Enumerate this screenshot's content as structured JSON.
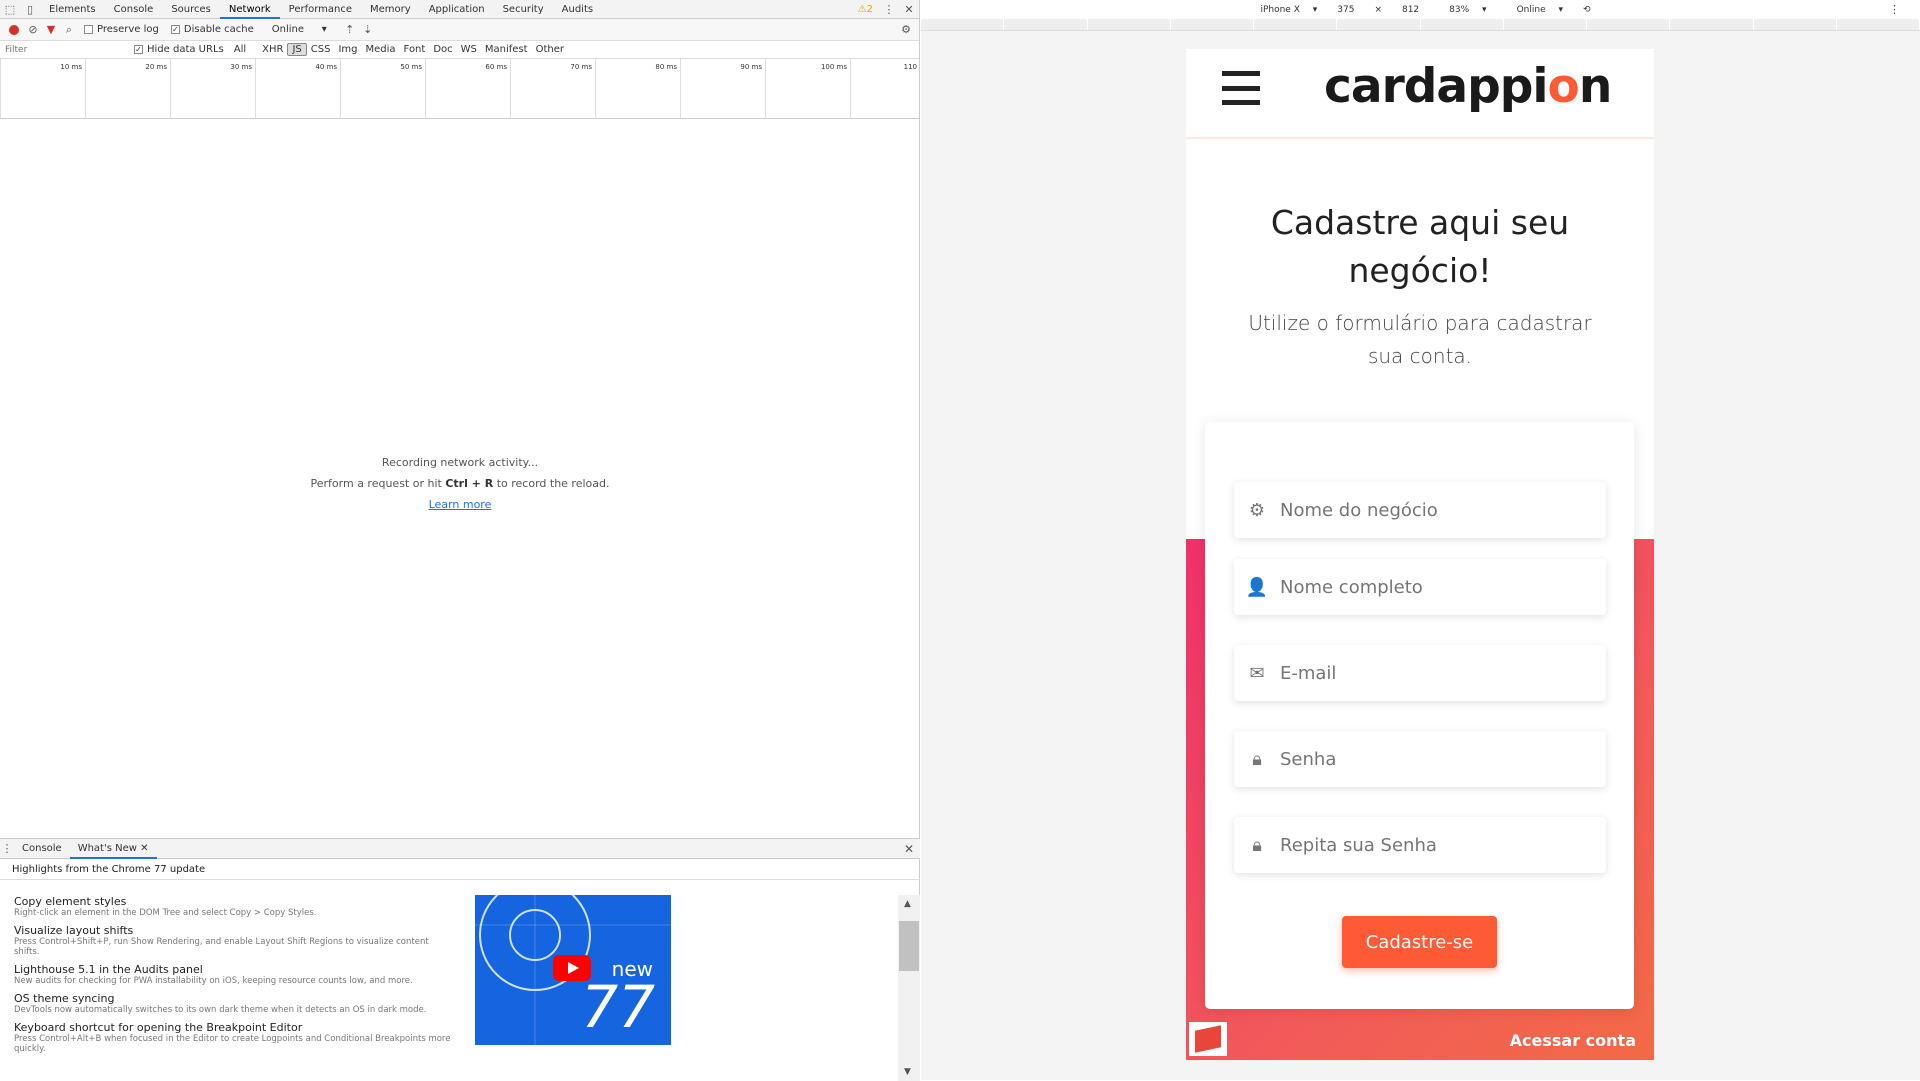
{
  "devtools": {
    "tabs": [
      "Elements",
      "Console",
      "Sources",
      "Network",
      "Performance",
      "Memory",
      "Application",
      "Security",
      "Audits"
    ],
    "active_tab": "Network",
    "warning_count": "2",
    "toolbar": {
      "preserve_log": "Preserve log",
      "disable_cache": "Disable cache",
      "throttle": "Online"
    },
    "filter": {
      "placeholder": "Filter",
      "hide_data_urls": "Hide data URLs",
      "types": [
        "All",
        "XHR",
        "JS",
        "CSS",
        "Img",
        "Media",
        "Font",
        "Doc",
        "WS",
        "Manifest",
        "Other"
      ],
      "selected_type": "JS"
    },
    "timeline_ticks": [
      "10 ms",
      "20 ms",
      "30 ms",
      "40 ms",
      "50 ms",
      "60 ms",
      "70 ms",
      "80 ms",
      "90 ms",
      "100 ms",
      "110"
    ],
    "empty_state": {
      "line1": "Recording network activity...",
      "line2_pre": "Perform a request or hit",
      "line2_key": "Ctrl + R",
      "line2_post": "to record the reload.",
      "learn_more": "Learn more"
    },
    "drawer": {
      "tabs": [
        "Console",
        "What's New"
      ],
      "active": "What's New",
      "highlight": "Highlights from the Chrome 77 update",
      "items": [
        {
          "title": "Copy element styles",
          "desc": "Right-click an element in the DOM Tree and select Copy > Copy Styles."
        },
        {
          "title": "Visualize layout shifts",
          "desc": "Press Control+Shift+P, run Show Rendering, and enable Layout Shift Regions to visualize content shifts."
        },
        {
          "title": "Lighthouse 5.1 in the Audits panel",
          "desc": "New audits for checking for PWA installability on iOS, keeping resource counts low, and more."
        },
        {
          "title": "OS theme syncing",
          "desc": "DevTools now automatically switches to its own dark theme when it detects an OS in dark mode."
        },
        {
          "title": "Keyboard shortcut for opening the Breakpoint Editor",
          "desc": "Press Control+Alt+B when focused in the Editor to create Logpoints and Conditional Breakpoints more quickly."
        }
      ],
      "video": {
        "new_label": "new",
        "version": "77"
      }
    }
  },
  "emulation": {
    "device": "iPhone X",
    "width": "375",
    "height": "812",
    "zoom": "83%",
    "network": "Online"
  },
  "site": {
    "logo_pre": "cardappi",
    "logo_o": "o",
    "logo_post": "n",
    "title": "Cadastre aqui seu negócio!",
    "subtitle": "Utilize o formulário para cadastrar sua conta.",
    "fields": [
      {
        "icon": "gear-icon",
        "placeholder": "Nome do negócio"
      },
      {
        "icon": "user-icon",
        "placeholder": "Nome completo"
      },
      {
        "icon": "envelope-icon",
        "placeholder": "E-mail"
      },
      {
        "icon": "lock-icon",
        "placeholder": "Senha"
      },
      {
        "icon": "lock-icon",
        "placeholder": "Repita sua Senha"
      }
    ],
    "submit": "Cadastre-se",
    "login_link": "Acessar conta",
    "accent": "#ff5a36",
    "gradient_start": "#f0306a",
    "gradient_end": "#f36a45"
  }
}
